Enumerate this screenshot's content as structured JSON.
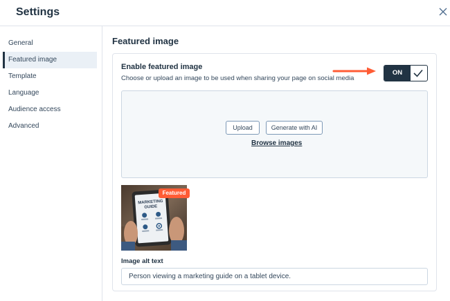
{
  "header": {
    "title": "Settings"
  },
  "sidebar": {
    "items": [
      {
        "label": "General"
      },
      {
        "label": "Featured image"
      },
      {
        "label": "Template"
      },
      {
        "label": "Language"
      },
      {
        "label": "Audience access"
      },
      {
        "label": "Advanced"
      }
    ],
    "active_index": 1
  },
  "main": {
    "title": "Featured image",
    "enable": {
      "label": "Enable featured image",
      "description": "Choose or upload an image to be used when sharing your page on social media",
      "toggle_label": "ON",
      "toggle_state": true
    },
    "dropzone": {
      "upload_label": "Upload",
      "generate_label": "Generate with AI",
      "browse_label": "Browse images"
    },
    "image": {
      "badge": "Featured",
      "screen_title": "MARKETING GUIDE"
    },
    "alt_text": {
      "label": "Image alt text",
      "value": "Person viewing a marketing guide on a tablet device."
    }
  },
  "colors": {
    "accent": "#ff5c35",
    "dark": "#213343",
    "text": "#33475b",
    "border": "#dfe3eb",
    "active_bg": "#eaf0f6"
  }
}
